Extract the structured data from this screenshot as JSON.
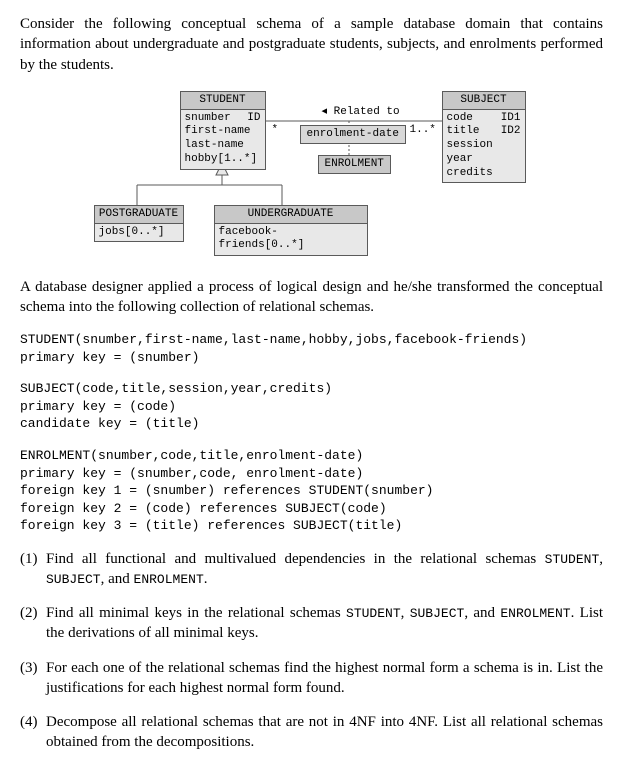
{
  "intro1": "Consider the following conceptual schema of a sample database domain that contains information about undergraduate and postgraduate students, subjects, and enrolments performed by the students.",
  "er": {
    "student": {
      "title": "STUDENT",
      "rows": [
        "snumber",
        "first-name",
        "last-name",
        "hobby[1..*]"
      ],
      "id": "ID"
    },
    "subject": {
      "title": "SUBJECT",
      "rows": [
        "code",
        "title",
        "session",
        "year",
        "credits"
      ],
      "id1": "ID1",
      "id2": "ID2"
    },
    "enrolment": {
      "title": "ENROLMENT",
      "attr": "enrolment-date"
    },
    "postgrad": {
      "title": "POSTGRADUATE",
      "row": "jobs[0..*]"
    },
    "undergrad": {
      "title": "UNDERGRADUATE",
      "row": "facebook-friends[0..*]"
    },
    "rel": "◂ Related to",
    "mult_left": "*",
    "mult_right": "1..*"
  },
  "intro2": "A database designer applied a process of logical design and he/she transformed the conceptual schema into the following collection of relational schemas.",
  "schemas": {
    "student": "STUDENT(snumber,first-name,last-name,hobby,jobs,facebook-friends)\nprimary key = (snumber)",
    "subject": "SUBJECT(code,title,session,year,credits)\nprimary key = (code)\ncandidate key = (title)",
    "enrolment": "ENROLMENT(snumber,code,title,enrolment-date)\nprimary key = (snumber,code, enrolment-date)\nforeign key 1 = (snumber) references STUDENT(snumber)\nforeign key 2 = (code) references SUBJECT(code)\nforeign key 3 = (title) references SUBJECT(title)"
  },
  "q1_a": "Find all functional and multivalued dependencies in the relational schemas ",
  "q1_codes": "STUDENT",
  "q1_b": ", ",
  "q1_codes2": "SUBJECT",
  "q1_c": ", and ",
  "q1_codes3": "ENROLMENT",
  "q1_d": ".",
  "q2_a": "Find all minimal keys in the relational schemas ",
  "q2_codes": "STUDENT",
  "q2_b": ", ",
  "q2_codes2": "SUBJECT",
  "q2_c": ", and ",
  "q2_codes3": "ENROLMENT",
  "q2_d": ". List the derivations of all minimal keys.",
  "q3": "For each one of the relational schemas find the highest normal form a schema is in. List the justifications for each highest normal form found.",
  "q4": "Decompose all relational schemas that are not in 4NF into 4NF. List all relational schemas obtained from the decompositions.",
  "qnums": {
    "q1": "(1)",
    "q2": "(2)",
    "q3": "(3)",
    "q4": "(4)"
  }
}
